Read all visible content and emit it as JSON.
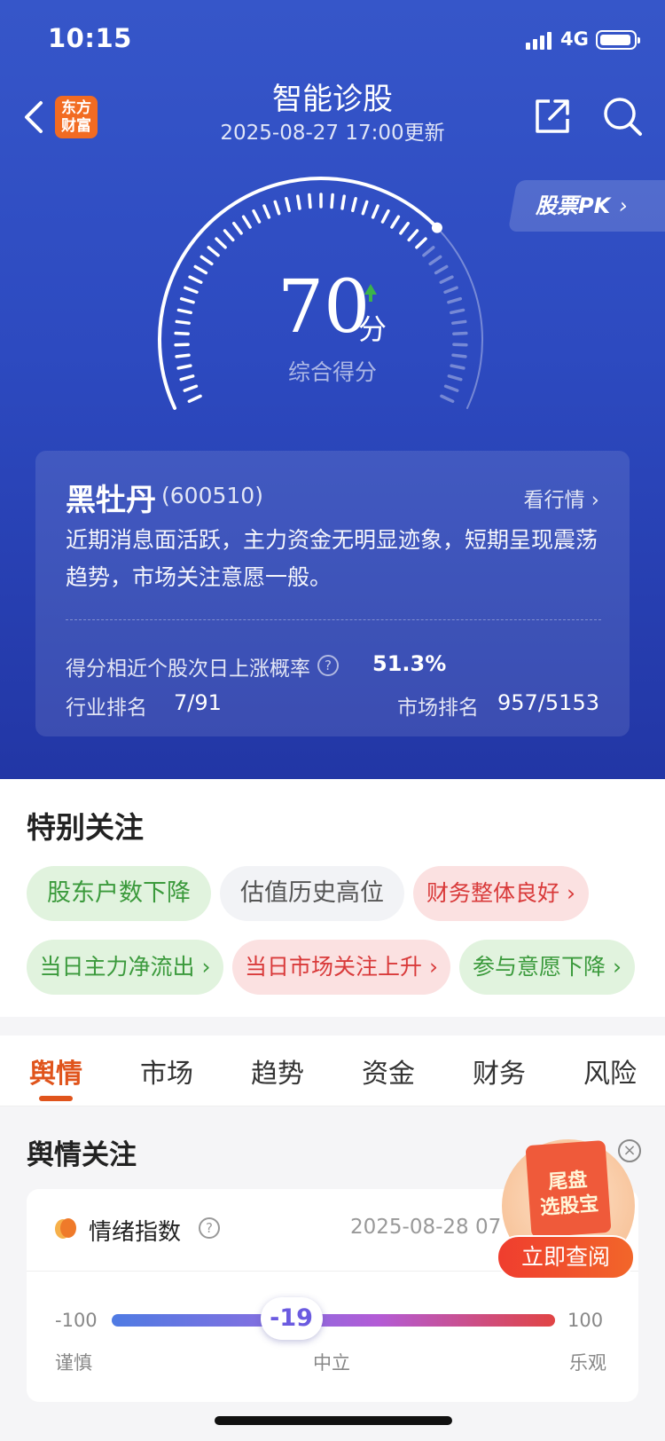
{
  "status": {
    "time": "10:15",
    "network": "4G"
  },
  "header": {
    "logo_line1": "东方",
    "logo_line2": "财富",
    "title": "智能诊股",
    "subtitle": "2025-08-27 17:00更新"
  },
  "pk_button": "股票PK",
  "gauge": {
    "score": "70",
    "unit": "分",
    "label": "综合得分",
    "score_value": 70,
    "trend": "up"
  },
  "stock": {
    "name": "黑牡丹",
    "code": "(600510)",
    "view_quote": "看行情",
    "summary": "近期消息面活跃，主力资金无明显迹象，短期呈现震荡趋势，市场关注意愿一般。",
    "prob_label": "得分相近个股次日上涨概率",
    "prob_value": "51.3%",
    "industry_label": "行业排名",
    "industry_value": "7/91",
    "market_label": "市场排名",
    "market_value": "957/5153"
  },
  "special_focus": {
    "title": "特别关注",
    "tags": [
      {
        "label": "股东户数下降",
        "tone": "green"
      },
      {
        "label": "估值历史高位",
        "tone": "neutral"
      },
      {
        "label": "财务整体良好",
        "tone": "red"
      },
      {
        "label": "当日主力净流出",
        "tone": "green"
      },
      {
        "label": "当日市场关注上升",
        "tone": "red"
      },
      {
        "label": "参与意愿下降",
        "tone": "green"
      }
    ]
  },
  "tabs": [
    "舆情",
    "市场",
    "趋势",
    "资金",
    "财务",
    "风险"
  ],
  "opinion": {
    "title": "舆情关注",
    "mood_label": "情绪指数",
    "date": "2025-08-28 07",
    "min": "-100",
    "max": "100",
    "value": "-19",
    "value_num": -19,
    "labels": {
      "cautious": "谨慎",
      "neutral": "中立",
      "optimistic": "乐观"
    }
  },
  "promo": {
    "line1": "尾盘",
    "line2": "选股宝",
    "button": "立即查阅"
  }
}
